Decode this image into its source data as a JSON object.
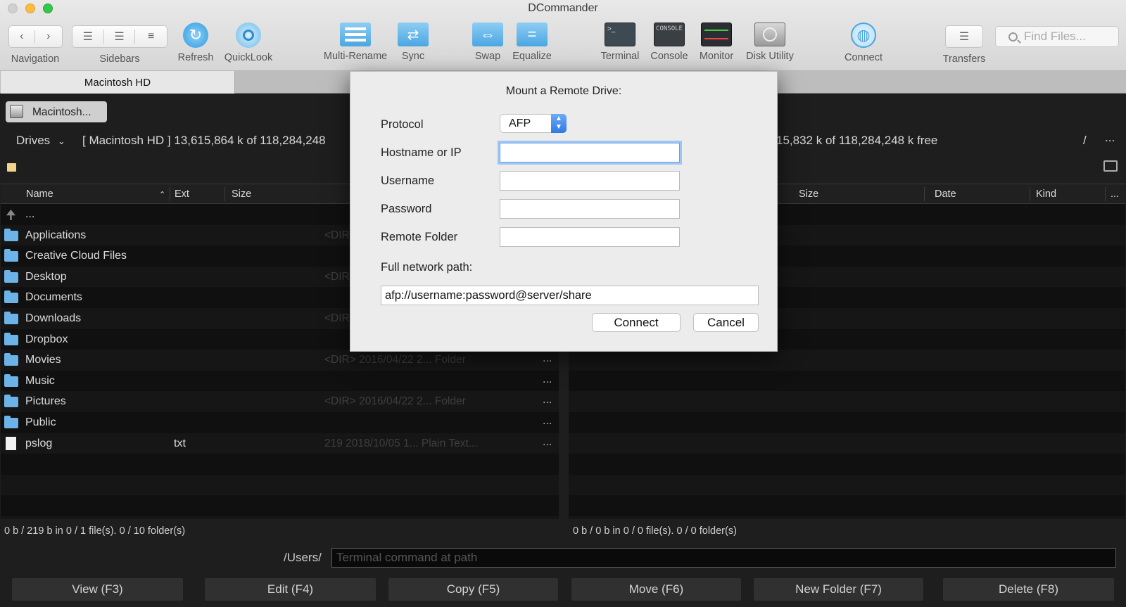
{
  "window": {
    "title": "DCommander"
  },
  "toolbar": {
    "navigation": "Navigation",
    "sidebars": "Sidebars",
    "refresh": "Refresh",
    "quicklook": "QuickLook",
    "multi_rename": "Multi-Rename",
    "sync": "Sync",
    "swap": "Swap",
    "equalize": "Equalize",
    "terminal": "Terminal",
    "console": "Console",
    "console_icon_text": "CONSOLE",
    "monitor": "Monitor",
    "disk_utility": "Disk Utility",
    "connect": "Connect",
    "transfers": "Transfers",
    "find_placeholder": "Find Files..."
  },
  "tab": {
    "label": "Macintosh HD"
  },
  "left_panel": {
    "volume_button": "Macintosh...",
    "drives": "Drives",
    "path_info": "[ Macintosh HD ]  13,615,864 k of 118,284,248",
    "columns": {
      "name": "Name",
      "ext": "Ext",
      "size": "Size"
    },
    "up_label": "...",
    "rows": [
      {
        "name": "Applications",
        "ext": "",
        "meta": "<DIR>"
      },
      {
        "name": "Creative Cloud Files",
        "ext": "",
        "meta": ""
      },
      {
        "name": "Desktop",
        "ext": "",
        "meta": "<DIR>"
      },
      {
        "name": "Documents",
        "ext": "",
        "meta": ""
      },
      {
        "name": "Downloads",
        "ext": "",
        "meta": "<DIR>"
      },
      {
        "name": "Dropbox",
        "ext": "",
        "meta": ""
      },
      {
        "name": "Movies",
        "ext": "",
        "meta": "<DIR>  2016/04/22 2...  Folder"
      },
      {
        "name": "Music",
        "ext": "",
        "meta": ""
      },
      {
        "name": "Pictures",
        "ext": "",
        "meta": "<DIR>  2016/04/22 2...  Folder"
      },
      {
        "name": "Public",
        "ext": "",
        "meta": ""
      },
      {
        "name": "pslog",
        "ext": "txt",
        "meta": "219  2018/10/05 1...  Plain Text..."
      }
    ],
    "row_more": "...",
    "status": "0 b / 219 b in 0 / 1 file(s).  0 / 10 folder(s)"
  },
  "right_panel": {
    "path_info": "15,832 k of 118,284,248 k free",
    "slash": "/",
    "more": "...",
    "columns": {
      "size": "Size",
      "date": "Date",
      "kind": "Kind",
      "more": "..."
    },
    "status": "0 b / 0 b in 0 / 0 file(s).  0 / 0 folder(s)"
  },
  "command_bar": {
    "path": "/Users/",
    "placeholder": "Terminal command at path"
  },
  "function_keys": [
    "View (F3)",
    "Edit (F4)",
    "Copy (F5)",
    "Move (F6)",
    "New Folder (F7)",
    "Delete (F8)"
  ],
  "dialog": {
    "title": "Mount a Remote Drive:",
    "protocol_label": "Protocol",
    "protocol_value": "AFP",
    "hostname_label": "Hostname or IP",
    "username_label": "Username",
    "password_label": "Password",
    "remote_folder_label": "Remote Folder",
    "hostname_value": "",
    "username_value": "",
    "password_value": "",
    "remote_folder_value": "",
    "full_path_label": "Full network path:",
    "full_path_value": "afp://username:password@server/share",
    "connect_button": "Connect",
    "cancel_button": "Cancel"
  },
  "colors": {
    "accent": "#2d7ae4",
    "panel_bg": "#101010",
    "folder": "#6cb4e8",
    "focus_ring": "#9ec5f3"
  }
}
